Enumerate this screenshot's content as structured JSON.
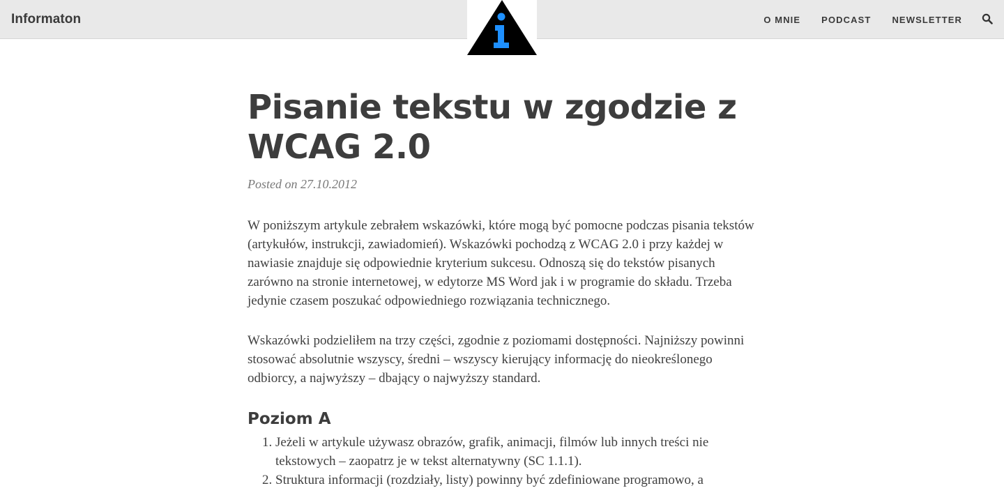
{
  "header": {
    "site_title": "Informaton",
    "nav": {
      "about": "O MNIE",
      "podcast": "PODCAST",
      "newsletter": "NEWSLETTER"
    },
    "logo_colors": {
      "triangle": "#000000",
      "letter": "#1e90ff"
    }
  },
  "post": {
    "title": "Pisanie tekstu w zgodzie z WCAG 2.0",
    "meta_prefix": "Posted on",
    "date": "27.10.2012",
    "paragraphs": [
      "W poniższym artykule zebrałem wskazówki, które mogą być pomocne podczas pisania tekstów (artykułów, instrukcji, zawiadomień). Wskazówki pochodzą z WCAG 2.0 i przy każdej w nawiasie znajduje się odpowiednie kryterium sukcesu. Odnoszą się do tekstów pisanych zarówno na stronie internetowej, w edytorze MS Word jak i w programie do składu. Trzeba jedynie czasem poszukać odpowiedniego rozwiązania technicznego.",
      "Wskazówki podzieliłem na trzy części, zgodnie z poziomami dostępności. Najniższy powinni stosować absolutnie wszyscy, średni – wszyscy kierujący informację do nieokreślonego odbiorcy, a najwyższy – dbający o najwyższy standard."
    ],
    "section_a": {
      "heading": "Poziom A",
      "items": [
        "Jeżeli w artykule używasz obrazów, grafik, animacji, filmów lub innych treści nie tekstowych – zaopatrz je w tekst alternatywny (SC 1.1.1).",
        "Struktura informacji (rozdziały, listy) powinny być zdefiniowane programowo, a"
      ]
    }
  }
}
